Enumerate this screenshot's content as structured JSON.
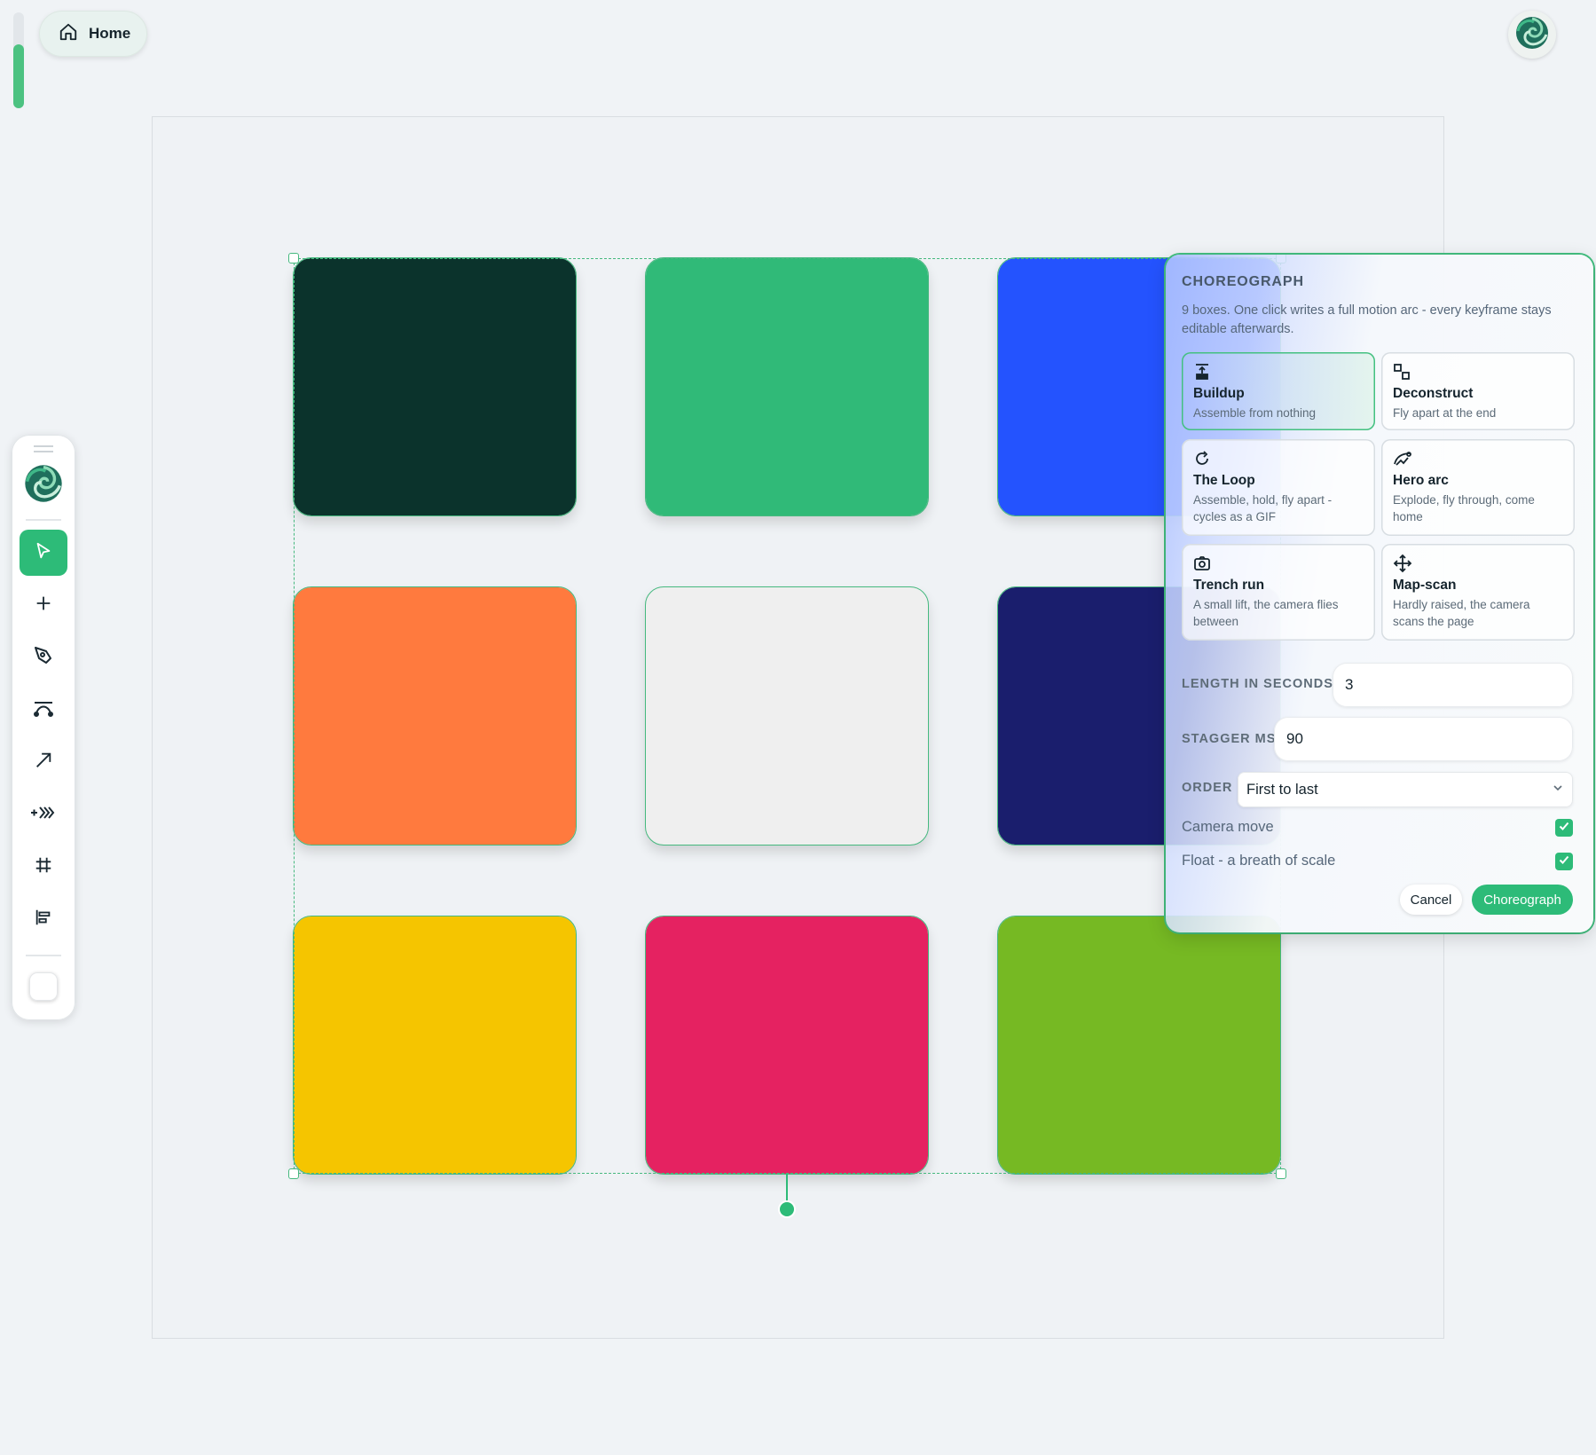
{
  "nav": {
    "home_label": "Home"
  },
  "toolbar": {
    "tools": [
      {
        "name": "select-tool",
        "icon": "cursor-arrow-icon",
        "active": true
      },
      {
        "name": "add-tool",
        "icon": "plus-icon"
      },
      {
        "name": "pen-tool",
        "icon": "pen-nib-icon"
      },
      {
        "name": "curve-tool",
        "icon": "bezier-curve-icon"
      },
      {
        "name": "arrow-tool",
        "icon": "arrow-up-right-icon"
      },
      {
        "name": "motion-tool",
        "icon": "fast-forward-plus-icon"
      },
      {
        "name": "grid-tool",
        "icon": "hash-grid-icon"
      },
      {
        "name": "align-tool",
        "icon": "align-left-icon"
      }
    ],
    "fill_color": "#ffffff"
  },
  "canvas": {
    "tiles": [
      {
        "name": "tile-dark-green",
        "color": "#0b332c"
      },
      {
        "name": "tile-green",
        "color": "#30ba78"
      },
      {
        "name": "tile-blue",
        "color": "#2453fe"
      },
      {
        "name": "tile-orange",
        "color": "#ff7a3e"
      },
      {
        "name": "tile-light-gray",
        "color": "#efefef"
      },
      {
        "name": "tile-navy",
        "color": "#1a1e6d"
      },
      {
        "name": "tile-yellow",
        "color": "#f5c500"
      },
      {
        "name": "tile-pink",
        "color": "#e52261"
      },
      {
        "name": "tile-lime",
        "color": "#76b923"
      }
    ]
  },
  "panel": {
    "title": "CHOREOGRAPH",
    "description": "9 boxes. One click writes a full motion arc - every keyframe stays editable afterwards.",
    "presets": [
      {
        "name": "Buildup",
        "desc": "Assemble from nothing",
        "icon": "stack-up-icon",
        "selected": true
      },
      {
        "name": "Deconstruct",
        "desc": "Fly apart at the end",
        "icon": "split-squares-icon"
      },
      {
        "name": "The Loop",
        "desc": "Assemble, hold, fly apart - cycles as a GIF",
        "icon": "loop-arrow-icon"
      },
      {
        "name": "Hero arc",
        "desc": "Explode, fly through, come home",
        "icon": "hero-arc-icon"
      },
      {
        "name": "Trench run",
        "desc": "A small lift, the camera flies between",
        "icon": "camera-icon"
      },
      {
        "name": "Map-scan",
        "desc": "Hardly raised, the camera scans the page",
        "icon": "move-arrows-icon"
      }
    ],
    "length_label": "LENGTH IN SECONDS",
    "length_value": "3",
    "stagger_label": "STAGGER MS",
    "stagger_value": "90",
    "order_label": "ORDER",
    "order_value": "First to last",
    "camera_move_label": "Camera move",
    "camera_move_checked": true,
    "float_label": "Float - a breath of scale",
    "float_checked": true,
    "cancel_label": "Cancel",
    "submit_label": "Choreograph"
  },
  "colors": {
    "accent": "#2dbb78",
    "panel_border": "#43c080"
  }
}
